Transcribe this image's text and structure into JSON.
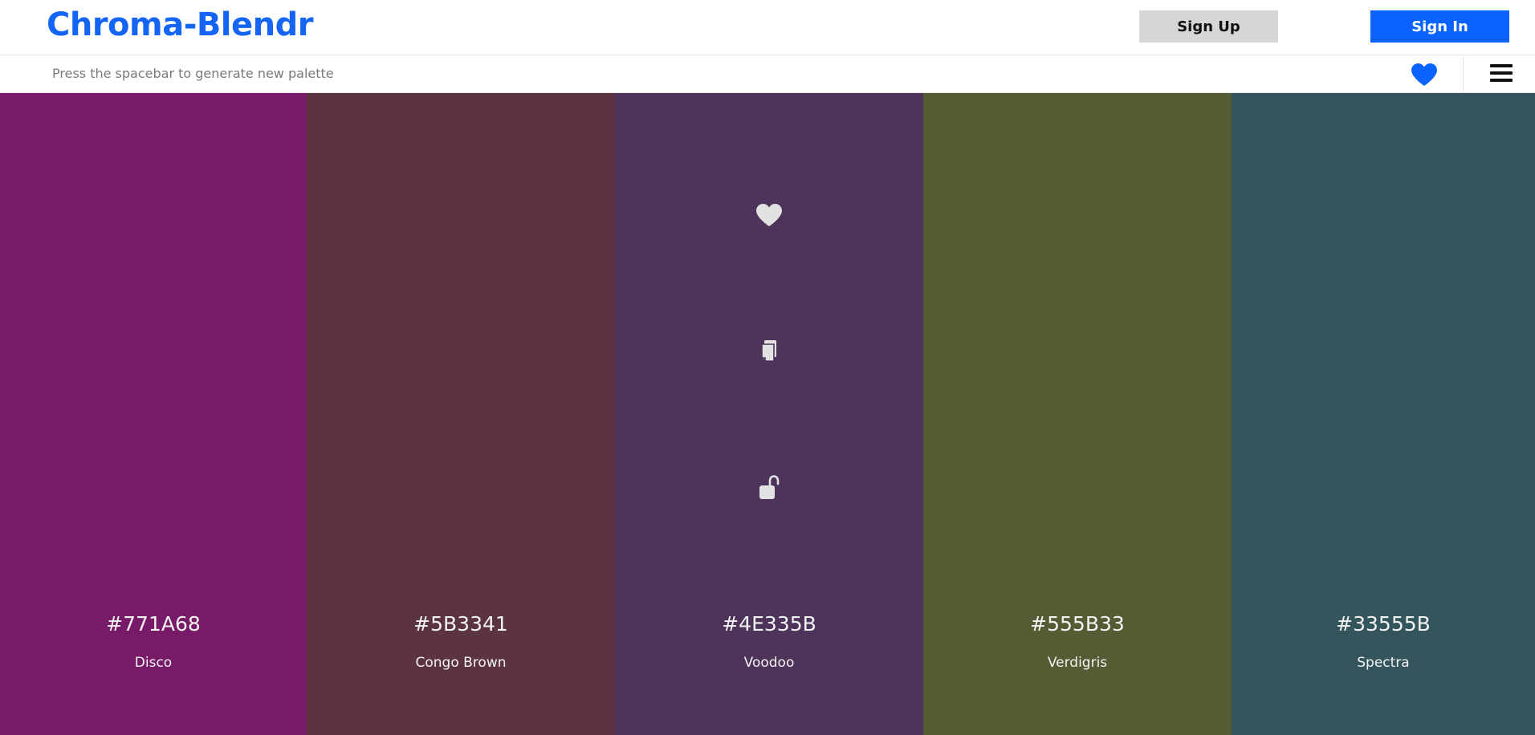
{
  "header": {
    "logo": "Chroma-Blendr",
    "signup_label": "Sign Up",
    "signin_label": "Sign In",
    "accent_color": "#0b63ff"
  },
  "subbar": {
    "hint": "Press the spacebar to generate new palette",
    "icons": [
      "heart-icon",
      "hamburger-menu-icon"
    ]
  },
  "palette": {
    "swatches": [
      {
        "hex": "#771A68",
        "name": "Disco",
        "color": "#771A68"
      },
      {
        "hex": "#5B3341",
        "name": "Congo Brown",
        "color": "#5B3341"
      },
      {
        "hex": "#4E335B",
        "name": "Voodoo",
        "color": "#4E335B"
      },
      {
        "hex": "#555B33",
        "name": "Verdigris",
        "color": "#555B33"
      },
      {
        "hex": "#33555B",
        "name": "Spectra",
        "color": "#33555B"
      }
    ],
    "hover_tools": [
      "heart-icon",
      "copy-icon",
      "unlock-icon"
    ],
    "tool_color": "#e2e2e2"
  }
}
